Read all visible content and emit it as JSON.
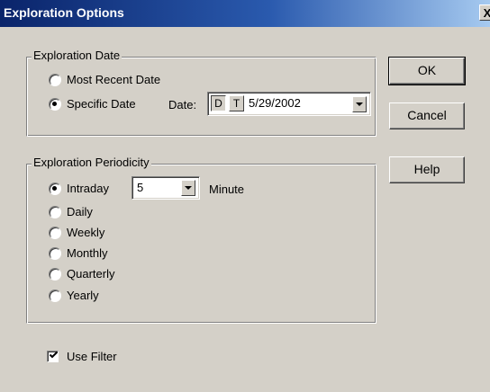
{
  "window": {
    "title": "Exploration Options",
    "close_glyph": "X"
  },
  "date_group": {
    "label": "Exploration Date",
    "options": [
      {
        "label": "Most Recent Date",
        "checked": false
      },
      {
        "label": "Specific Date",
        "checked": true
      }
    ],
    "date_label": "Date:",
    "d_toggle": "D",
    "t_toggle": "T",
    "date_value": "5/29/2002"
  },
  "periodicity_group": {
    "label": "Exploration Periodicity",
    "intraday_value": "5",
    "minute_label": "Minute",
    "options": [
      {
        "label": "Intraday",
        "checked": true
      },
      {
        "label": "Daily",
        "checked": false
      },
      {
        "label": "Weekly",
        "checked": false
      },
      {
        "label": "Monthly",
        "checked": false
      },
      {
        "label": "Quarterly",
        "checked": false
      },
      {
        "label": "Yearly",
        "checked": false
      }
    ]
  },
  "buttons": {
    "ok": "OK",
    "cancel": "Cancel",
    "help": "Help"
  },
  "use_filter": {
    "label": "Use Filter",
    "checked": true
  },
  "icons": {
    "close": "close-icon",
    "dropdown": "chevron-down-icon",
    "check": "checkmark-icon"
  }
}
